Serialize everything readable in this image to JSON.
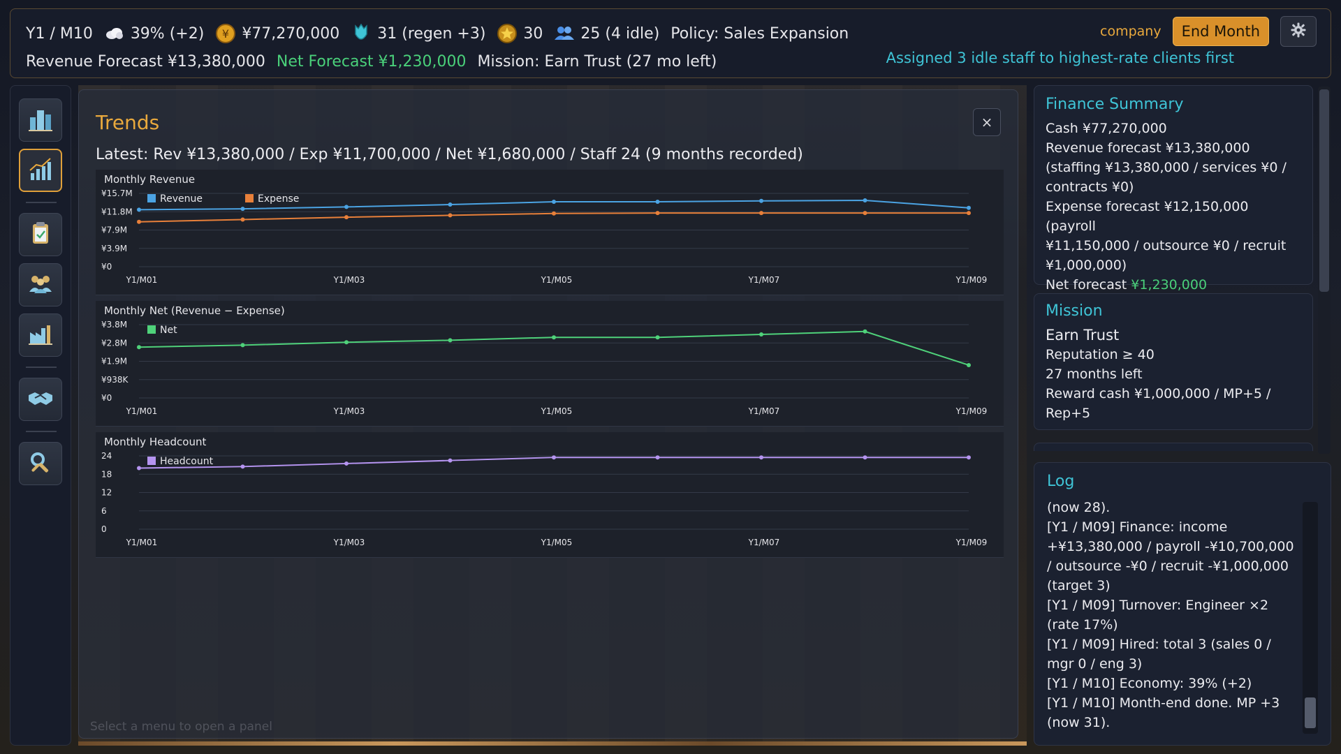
{
  "header": {
    "date": "Y1 / M10",
    "economy": "39% (+2)",
    "cash": "¥77,270,000",
    "mp": "31 (regen +3)",
    "reputation": "30",
    "staff": "25 (4 idle)",
    "policy": "Policy: Sales Expansion",
    "revenue_forecast": "Revenue Forecast ¥13,380,000",
    "net_forecast": "Net Forecast ¥1,230,000",
    "mission": "Mission: Earn Trust (27 mo left)",
    "company_label": "company",
    "end_month_label": "End Month",
    "assigned_msg": "Assigned 3 idle staff to highest-rate clients first"
  },
  "nav": {
    "items": [
      {
        "icon": "buildings-icon",
        "active": false
      },
      {
        "icon": "bar-chart-icon",
        "active": true
      },
      {
        "icon": "clipboard-icon",
        "active": false
      },
      {
        "icon": "team-icon",
        "active": false
      },
      {
        "icon": "factory-icon",
        "active": false
      },
      {
        "icon": "handshake-icon",
        "active": false
      },
      {
        "icon": "tools-icon",
        "active": false
      }
    ]
  },
  "trends": {
    "title": "Trends",
    "close_label": "×",
    "latest": "Latest: Rev ¥13,380,000 / Exp ¥11,700,000 / Net ¥1,680,000 / Staff 24 (9 months recorded)",
    "hint": "Select a menu to open a panel"
  },
  "chart_data": [
    {
      "type": "line",
      "title": "Monthly Revenue",
      "x": [
        "Y1/M01",
        "Y1/M02",
        "Y1/M03",
        "Y1/M04",
        "Y1/M05",
        "Y1/M06",
        "Y1/M07",
        "Y1/M08",
        "Y1/M09"
      ],
      "x_tick_labels": [
        "Y1/M01",
        "Y1/M03",
        "Y1/M05",
        "Y1/M07",
        "Y1/M09"
      ],
      "y_tick_labels": [
        "¥15.7M",
        "¥11.8M",
        "¥7.9M",
        "¥3.9M",
        "¥0"
      ],
      "ylim": [
        0,
        15700000
      ],
      "series": [
        {
          "name": "Revenue",
          "color": "#4ba3e3",
          "values": [
            12200000,
            12400000,
            12800000,
            13300000,
            13900000,
            13900000,
            14100000,
            14200000,
            12600000
          ]
        },
        {
          "name": "Expense",
          "color": "#e8803a",
          "values": [
            9600000,
            10100000,
            10600000,
            11000000,
            11400000,
            11500000,
            11500000,
            11500000,
            11500000
          ]
        }
      ]
    },
    {
      "type": "line",
      "title": "Monthly Net (Revenue − Expense)",
      "x": [
        "Y1/M01",
        "Y1/M02",
        "Y1/M03",
        "Y1/M04",
        "Y1/M05",
        "Y1/M06",
        "Y1/M07",
        "Y1/M08",
        "Y1/M09"
      ],
      "x_tick_labels": [
        "Y1/M01",
        "Y1/M03",
        "Y1/M05",
        "Y1/M07",
        "Y1/M09"
      ],
      "y_tick_labels": [
        "¥3.8M",
        "¥2.8M",
        "¥1.9M",
        "¥938K",
        "¥0"
      ],
      "ylim": [
        0,
        3750000
      ],
      "series": [
        {
          "name": "Net",
          "color": "#4fd27a",
          "values": [
            2600000,
            2700000,
            2850000,
            2950000,
            3100000,
            3100000,
            3250000,
            3400000,
            1680000
          ]
        }
      ]
    },
    {
      "type": "line",
      "title": "Monthly Headcount",
      "x": [
        "Y1/M01",
        "Y1/M02",
        "Y1/M03",
        "Y1/M04",
        "Y1/M05",
        "Y1/M06",
        "Y1/M07",
        "Y1/M08",
        "Y1/M09"
      ],
      "x_tick_labels": [
        "Y1/M01",
        "Y1/M03",
        "Y1/M05",
        "Y1/M07",
        "Y1/M09"
      ],
      "y_tick_labels": [
        "24",
        "18",
        "12",
        "6",
        "0"
      ],
      "ylim": [
        0,
        24
      ],
      "series": [
        {
          "name": "Headcount",
          "color": "#b594f0",
          "values": [
            20,
            20.5,
            21.5,
            22.5,
            23.5,
            23.5,
            23.5,
            23.5,
            23.5
          ]
        }
      ]
    }
  ],
  "finance": {
    "title": "Finance Summary",
    "cash": "Cash ¥77,270,000",
    "revenue_1": "Revenue forecast ¥13,380,000",
    "revenue_2": "(staffing ¥13,380,000 / services ¥0 /",
    "revenue_3": "contracts ¥0)",
    "expense_1": "Expense forecast ¥12,150,000 (payroll",
    "expense_2": "¥11,150,000 / outsource ¥0 / recruit",
    "expense_3": "¥1,000,000)",
    "net_label": "Net forecast ",
    "net_value": "¥1,230,000"
  },
  "mission": {
    "title": "Mission",
    "name": "Earn Trust",
    "req": "Reputation ≥ 40",
    "left": "27 months left",
    "reward_1": "Reward cash ¥1,000,000 / MP+5 /",
    "reward_2": "Rep+5"
  },
  "log": {
    "title": "Log",
    "lines": [
      "(now 28).",
      "[Y1 / M09] Finance: income",
      "+¥13,380,000 / payroll -¥10,700,000",
      "/ outsource -¥0 / recruit -¥1,000,000",
      "(target 3)",
      "[Y1 / M09] Turnover: Engineer ×2",
      "(rate 17%)",
      "[Y1 / M09] Hired: total 3 (sales 0 /",
      "mgr 0 / eng 3)",
      "[Y1 / M10] Economy: 39% (+2)",
      "[Y1 / M10] Month-end done. MP +3",
      "(now 31)."
    ]
  }
}
